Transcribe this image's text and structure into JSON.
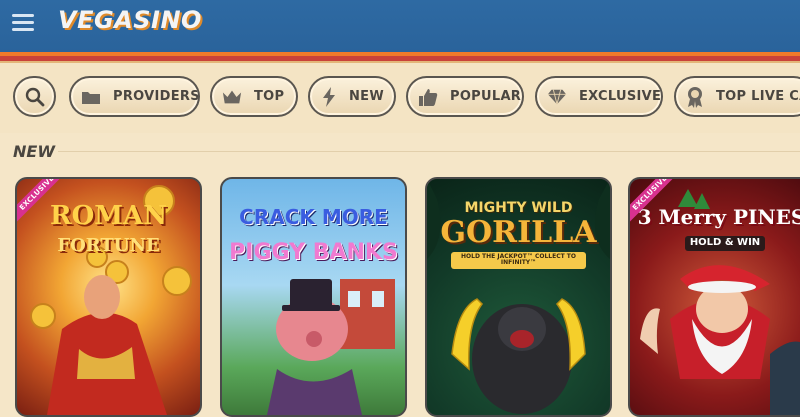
{
  "header": {
    "logo_text": "VEGASINO",
    "menu_icon": "hamburger-icon"
  },
  "filters": {
    "search_icon": "search-icon",
    "chips": [
      {
        "label": "PROVIDERS",
        "icon": "folder-icon"
      },
      {
        "label": "TOP",
        "icon": "crown-icon"
      },
      {
        "label": "NEW",
        "icon": "lightning-icon"
      },
      {
        "label": "POPULAR",
        "icon": "thumbs-up-icon"
      },
      {
        "label": "EXCLUSIVE",
        "icon": "diamond-icon"
      },
      {
        "label": "TOP LIVE CA",
        "icon": "award-icon"
      }
    ]
  },
  "section": {
    "title": "NEW"
  },
  "games": [
    {
      "line1": "ROMAN",
      "line2": "FORTUNE",
      "badge": "EXCLUSIVE"
    },
    {
      "line1": "CRACK MORE",
      "line2": "PIGGY BANKS",
      "badge": ""
    },
    {
      "line1": "MIGHTY WILD",
      "line2": "GORILLA",
      "sub": "HOLD THE JACKPOT™ COLLECT TO INFINITY™",
      "badge": ""
    },
    {
      "line1": "3 Merry PINES",
      "line2": "HOLD & WIN",
      "badge": "EXCLUSIVE"
    }
  ],
  "colors": {
    "header_bg": "#2e6aa3",
    "accent_orange": "#f07a2a",
    "accent_red": "#c9423a",
    "page_bg": "#f5e6c8",
    "chip_border": "#5a5650"
  }
}
